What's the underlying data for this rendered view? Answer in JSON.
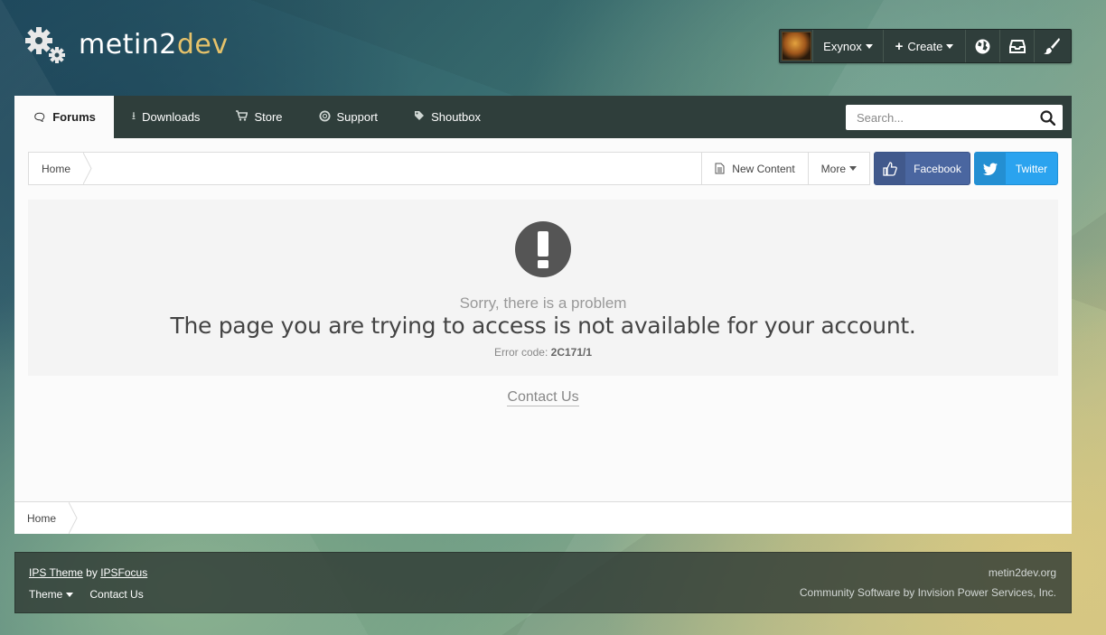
{
  "brand": {
    "name_main": "metin2",
    "name_accent": "dev"
  },
  "userbar": {
    "username": "Exynox",
    "create_label": "Create",
    "icons": [
      "globe-icon",
      "inbox-icon",
      "paintbrush-icon"
    ]
  },
  "nav": {
    "tabs": [
      {
        "label": "Forums",
        "icon": "comments-icon",
        "active": true
      },
      {
        "label": "Downloads",
        "icon": "download-icon",
        "active": false
      },
      {
        "label": "Store",
        "icon": "cart-icon",
        "active": false
      },
      {
        "label": "Support",
        "icon": "lifebuoy-icon",
        "active": false
      },
      {
        "label": "Shoutbox",
        "icon": "tag-icon",
        "active": false
      }
    ],
    "search_placeholder": "Search..."
  },
  "breadcrumb": {
    "home": "Home",
    "new_content": "New Content",
    "more": "More"
  },
  "social": {
    "facebook": "Facebook",
    "twitter": "Twitter"
  },
  "error": {
    "subtitle": "Sorry, there is a problem",
    "message": "The page you are trying to access is not available for your account.",
    "code_label": "Error code:",
    "code": "2C171/1",
    "contact": "Contact Us"
  },
  "footer": {
    "theme_link": "IPS Theme",
    "by": "by",
    "author": "IPSFocus",
    "theme_menu": "Theme",
    "contact": "Contact Us",
    "site": "metin2dev.org",
    "powered": "Community Software by Invision Power Services, Inc."
  },
  "colors": {
    "nav_bg": "#2f3e3b",
    "accent_gold": "#e6c26a",
    "facebook": "#4a66a0",
    "twitter": "#2aa3ef"
  }
}
